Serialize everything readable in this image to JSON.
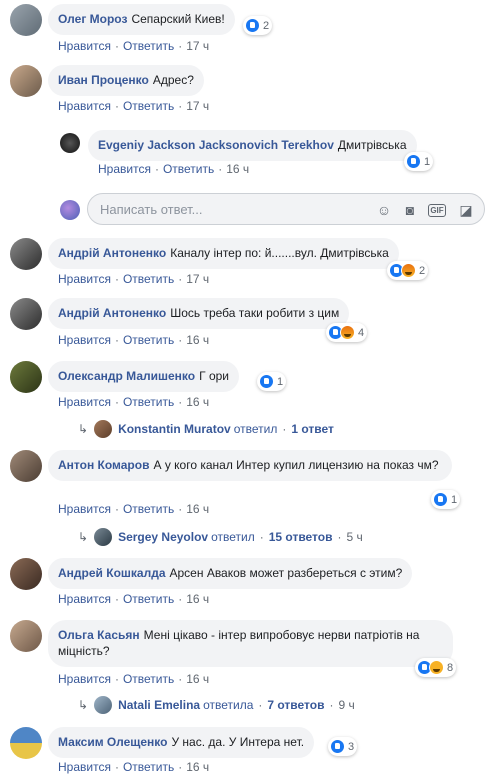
{
  "labels": {
    "like": "Нравится",
    "reply": "Ответить",
    "sep": "·"
  },
  "write_reply": {
    "placeholder": "Написать ответ..."
  },
  "comments": [
    {
      "author": "Олег Мороз",
      "text": "Сепарский Киев!",
      "time": "17 ч",
      "reactions": "2"
    },
    {
      "author": "Иван Проценко",
      "text": "Адрес?",
      "time": "17 ч"
    },
    {
      "author": "Evgeniy Jackson Jacksonovich Terekhov",
      "text": "Дмитрівська",
      "time": "16 ч",
      "reactions": "1"
    },
    {
      "author": "Андрій Антоненко",
      "text": "Каналу інтер по: й.......вул. Дмитрівська",
      "time": "17 ч",
      "reactions": "2"
    },
    {
      "author": "Андрій Антоненко",
      "text": "Шось треба таки робити з цим",
      "time": "16 ч",
      "reactions": "4"
    },
    {
      "author": "Олександр Малишенко",
      "text": "Г ори",
      "time": "16 ч",
      "reactions": "1"
    },
    {
      "author": "Антон Комаров",
      "text": "А у кого канал Интер купил лицензию на показ чм?",
      "time": "16 ч",
      "reactions": "1"
    },
    {
      "author": "Андрей Кошкалда",
      "text": "Арсен Аваков может разбереться с этим?",
      "time": "16 ч"
    },
    {
      "author": "Ольга Касьян",
      "text": "Мені цікаво - інтер випробовує нерви патріотів на міцність?",
      "time": "16 ч",
      "reactions": "8"
    },
    {
      "author": "Максим Олещенко",
      "text": "У нас. да. У Интера нет.",
      "time": "16 ч",
      "reactions": "3"
    }
  ],
  "reply_summaries": [
    {
      "name": "Konstantin Muratov",
      "verb": "ответил",
      "count": "1 ответ",
      "time": ""
    },
    {
      "name": "Sergey Neyolov",
      "verb": "ответил",
      "count": "15 ответов",
      "time": "5 ч"
    },
    {
      "name": "Natali Emelina",
      "verb": "ответила",
      "count": "7 ответов",
      "time": "9 ч"
    }
  ]
}
